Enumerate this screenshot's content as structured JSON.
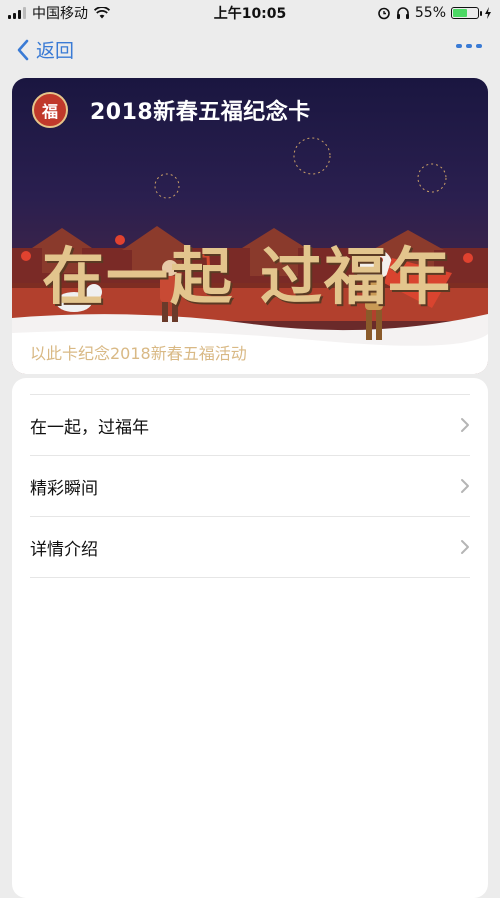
{
  "status_bar": {
    "carrier": "中国移动",
    "time": "上午10:05",
    "battery_pct": "55%",
    "battery_level": 0.55,
    "icons": [
      "signal-icon",
      "wifi-icon",
      "alarm-icon",
      "headphones-icon",
      "battery-icon",
      "charging-icon"
    ]
  },
  "nav": {
    "back_label": "返回",
    "more_icon": "more-icon"
  },
  "card": {
    "badge_text": "福",
    "title": "2018新春五福纪念卡",
    "calligraphy_left": "在一起",
    "calligraphy_right": "过福年",
    "caption": "以此卡纪念2018新春五福活动"
  },
  "list": {
    "items": [
      {
        "label": "在一起，过福年"
      },
      {
        "label": "精彩瞬间"
      },
      {
        "label": "详情介绍"
      }
    ]
  },
  "colors": {
    "accent": "#3a7bd5",
    "card_bg_top": "#1a1640",
    "gold": "#e3c58d",
    "red": "#c0392b"
  }
}
